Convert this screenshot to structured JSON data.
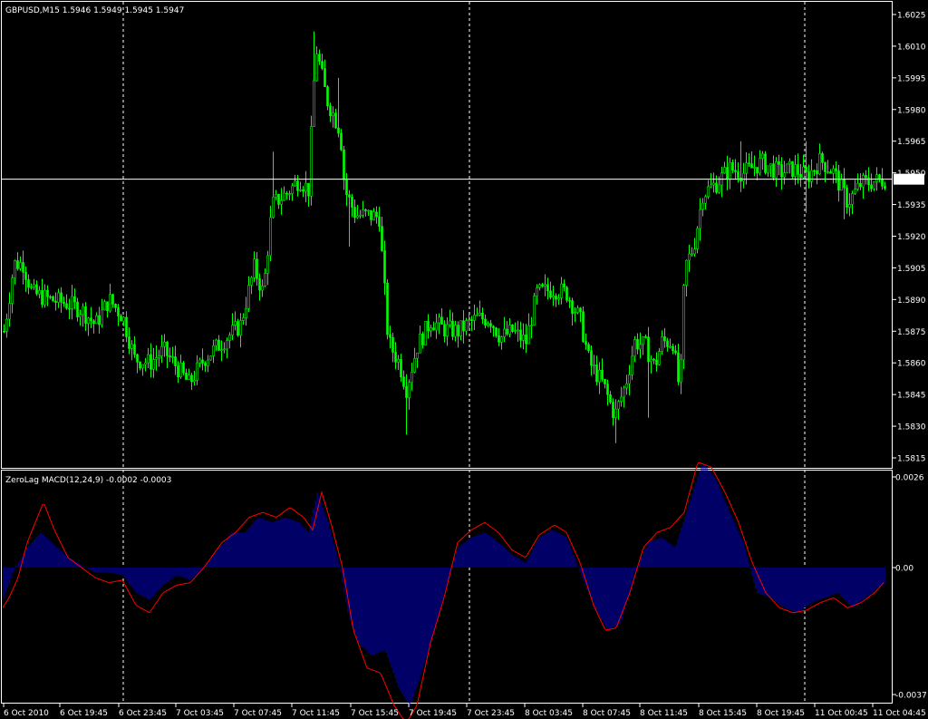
{
  "colors": {
    "background": "#000000",
    "frame": "#ffffff",
    "bull_candle": "#00ff00",
    "bear_candle": "#00ff00",
    "histogram": "#0000cc",
    "signal": "#ff0000",
    "bid_line": "#ffffff",
    "price_badge_bg": "#ffffff",
    "price_badge_text": "#000000"
  },
  "chart_data": [
    {
      "type": "candlestick",
      "title": "GBPUSD,M15  1.5946 1.5949 1.5945 1.5947",
      "symbol": "GBPUSD",
      "timeframe": "M15",
      "current_price": "1.5947",
      "ylim": [
        1.5809,
        1.603
      ],
      "y_ticks": [
        "1.6025",
        "1.6010",
        "1.5995",
        "1.5980",
        "1.5965",
        "1.5950",
        "1.5935",
        "1.5920",
        "1.5905",
        "1.5890",
        "1.5875",
        "1.5860",
        "1.5845",
        "1.5830",
        "1.5815"
      ],
      "grid": "vertical dashed separators at 6 Oct 19:45-23:45, 7 Oct 19:45-23:45, 10 Oct 21:00",
      "anchors": [
        [
          0,
          1.5865
        ],
        [
          6,
          1.588
        ],
        [
          15,
          1.5907
        ],
        [
          25,
          1.5907
        ],
        [
          35,
          1.5893
        ],
        [
          55,
          1.589
        ],
        [
          75,
          1.5888
        ],
        [
          90,
          1.5885
        ],
        [
          105,
          1.5878
        ],
        [
          120,
          1.589
        ],
        [
          135,
          1.5882
        ],
        [
          148,
          1.5862
        ],
        [
          165,
          1.586
        ],
        [
          180,
          1.5866
        ],
        [
          195,
          1.5858
        ],
        [
          208,
          1.585
        ],
        [
          225,
          1.5862
        ],
        [
          245,
          1.587
        ],
        [
          265,
          1.5878
        ],
        [
          280,
          1.5905
        ],
        [
          290,
          1.5893
        ],
        [
          300,
          1.5935
        ],
        [
          315,
          1.594
        ],
        [
          330,
          1.5947
        ],
        [
          340,
          1.5942
        ],
        [
          348,
          1.601
        ],
        [
          360,
          1.5985
        ],
        [
          375,
          1.597
        ],
        [
          380,
          1.5942
        ],
        [
          392,
          1.593
        ],
        [
          405,
          1.593
        ],
        [
          418,
          1.5929
        ],
        [
          428,
          1.587
        ],
        [
          440,
          1.586
        ],
        [
          448,
          1.5848
        ],
        [
          460,
          1.5868
        ],
        [
          475,
          1.588
        ],
        [
          490,
          1.5876
        ],
        [
          505,
          1.5875
        ],
        [
          525,
          1.5881
        ],
        [
          540,
          1.5881
        ],
        [
          552,
          1.5872
        ],
        [
          565,
          1.5875
        ],
        [
          580,
          1.587
        ],
        [
          592,
          1.5893
        ],
        [
          610,
          1.5895
        ],
        [
          625,
          1.5893
        ],
        [
          640,
          1.588
        ],
        [
          650,
          1.586
        ],
        [
          665,
          1.585
        ],
        [
          678,
          1.5835
        ],
        [
          690,
          1.585
        ],
        [
          700,
          1.587
        ],
        [
          712,
          1.5868
        ],
        [
          722,
          1.5858
        ],
        [
          730,
          1.587
        ],
        [
          742,
          1.587
        ],
        [
          750,
          1.5845
        ],
        [
          755,
          1.5905
        ],
        [
          765,
          1.5915
        ],
        [
          775,
          1.594
        ],
        [
          790,
          1.5945
        ],
        [
          805,
          1.5952
        ],
        [
          820,
          1.595
        ],
        [
          840,
          1.5955
        ],
        [
          860,
          1.595
        ],
        [
          875,
          1.5952
        ],
        [
          890,
          1.5948
        ],
        [
          905,
          1.5956
        ],
        [
          920,
          1.595
        ],
        [
          935,
          1.5936
        ],
        [
          950,
          1.5945
        ],
        [
          965,
          1.5946
        ],
        [
          978,
          1.5947
        ]
      ],
      "spikes": [
        {
          "x": 300,
          "high": 1.596
        },
        {
          "x": 345,
          "high": 1.6017
        },
        {
          "x": 372,
          "high": 1.5995
        },
        {
          "x": 386,
          "low": 1.5915
        },
        {
          "x": 448,
          "low": 1.5826
        },
        {
          "x": 680,
          "low": 1.5822
        },
        {
          "x": 715,
          "low": 1.5834
        },
        {
          "x": 818,
          "high": 1.5965
        },
        {
          "x": 888,
          "high": 1.5965
        },
        {
          "x": 888,
          "low": 1.5931
        },
        {
          "x": 930,
          "low": 1.5928
        }
      ]
    },
    {
      "type": "histogram+line",
      "title": "ZeroLag MACD(12,24,9) -0.0002 -0.0003",
      "ylim": [
        -0.0037,
        0.0026
      ],
      "y_ticks": [
        "0.0026",
        "0.00",
        "-0.0037"
      ],
      "macd_anchors": [
        [
          0,
          -0.0016
        ],
        [
          15,
          -0.0001
        ],
        [
          30,
          0.0008
        ],
        [
          45,
          0.0014
        ],
        [
          60,
          0.0009
        ],
        [
          75,
          0.0004
        ],
        [
          90,
          0.0001
        ],
        [
          105,
          -0.0002
        ],
        [
          120,
          -0.0002
        ],
        [
          135,
          -0.0003
        ],
        [
          150,
          -0.001
        ],
        [
          165,
          -0.0013
        ],
        [
          180,
          -0.0007
        ],
        [
          195,
          -0.0003
        ],
        [
          210,
          -0.0005
        ],
        [
          225,
          0.0
        ],
        [
          240,
          0.0007
        ],
        [
          255,
          0.0014
        ],
        [
          270,
          0.0014
        ],
        [
          285,
          0.002
        ],
        [
          300,
          0.0018
        ],
        [
          315,
          0.002
        ],
        [
          330,
          0.0018
        ],
        [
          340,
          0.0014
        ],
        [
          350,
          0.003
        ],
        [
          362,
          0.0018
        ],
        [
          375,
          0.0
        ],
        [
          385,
          -0.002
        ],
        [
          395,
          -0.003
        ],
        [
          410,
          -0.0035
        ],
        [
          425,
          -0.0033
        ],
        [
          440,
          -0.0048
        ],
        [
          452,
          -0.0055
        ],
        [
          462,
          -0.0045
        ],
        [
          475,
          -0.003
        ],
        [
          490,
          -0.001
        ],
        [
          505,
          0.0008
        ],
        [
          520,
          0.0012
        ],
        [
          535,
          0.0014
        ],
        [
          550,
          0.001
        ],
        [
          565,
          0.0005
        ],
        [
          580,
          0.0002
        ],
        [
          595,
          0.0012
        ],
        [
          610,
          0.0015
        ],
        [
          625,
          0.0012
        ],
        [
          640,
          -0.0002
        ],
        [
          655,
          -0.0015
        ],
        [
          670,
          -0.0025
        ],
        [
          685,
          -0.0022
        ],
        [
          700,
          -0.0002
        ],
        [
          715,
          0.001
        ],
        [
          730,
          0.0012
        ],
        [
          745,
          0.0008
        ],
        [
          760,
          0.0025
        ],
        [
          775,
          0.0042
        ],
        [
          790,
          0.0035
        ],
        [
          805,
          0.0022
        ],
        [
          820,
          0.001
        ],
        [
          835,
          -0.001
        ],
        [
          850,
          -0.0012
        ],
        [
          865,
          -0.0016
        ],
        [
          880,
          -0.0018
        ],
        [
          895,
          -0.0014
        ],
        [
          910,
          -0.0012
        ],
        [
          925,
          -0.001
        ],
        [
          940,
          -0.0016
        ],
        [
          955,
          -0.0012
        ],
        [
          968,
          -0.0008
        ],
        [
          978,
          -0.0006
        ]
      ],
      "signal_anchors": [
        [
          3,
          -0.0016
        ],
        [
          10,
          -0.0012
        ],
        [
          20,
          -0.0004
        ],
        [
          30,
          0.001
        ],
        [
          48,
          0.0026
        ],
        [
          60,
          0.0015
        ],
        [
          75,
          0.0004
        ],
        [
          90,
          0.0
        ],
        [
          105,
          -0.0004
        ],
        [
          120,
          -0.0006
        ],
        [
          135,
          -0.0005
        ],
        [
          150,
          -0.0015
        ],
        [
          165,
          -0.0018
        ],
        [
          180,
          -0.001
        ],
        [
          195,
          -0.0007
        ],
        [
          210,
          -0.0006
        ],
        [
          225,
          0.0
        ],
        [
          245,
          0.001
        ],
        [
          260,
          0.0014
        ],
        [
          275,
          0.002
        ],
        [
          290,
          0.0022
        ],
        [
          305,
          0.002
        ],
        [
          320,
          0.0024
        ],
        [
          335,
          0.002
        ],
        [
          345,
          0.0015
        ],
        [
          355,
          0.003
        ],
        [
          365,
          0.0018
        ],
        [
          378,
          0.0
        ],
        [
          390,
          -0.0025
        ],
        [
          405,
          -0.004
        ],
        [
          420,
          -0.0042
        ],
        [
          435,
          -0.0055
        ],
        [
          448,
          -0.0062
        ],
        [
          460,
          -0.0055
        ],
        [
          475,
          -0.003
        ],
        [
          490,
          -0.0012
        ],
        [
          505,
          0.001
        ],
        [
          520,
          0.0015
        ],
        [
          535,
          0.0018
        ],
        [
          550,
          0.0014
        ],
        [
          565,
          0.0007
        ],
        [
          580,
          0.0004
        ],
        [
          595,
          0.0013
        ],
        [
          612,
          0.0017
        ],
        [
          625,
          0.0014
        ],
        [
          640,
          0.0002
        ],
        [
          655,
          -0.0015
        ],
        [
          668,
          -0.0025
        ],
        [
          680,
          -0.0024
        ],
        [
          695,
          -0.001
        ],
        [
          710,
          0.0008
        ],
        [
          725,
          0.0014
        ],
        [
          740,
          0.0016
        ],
        [
          755,
          0.0022
        ],
        [
          770,
          0.0042
        ],
        [
          785,
          0.004
        ],
        [
          800,
          0.003
        ],
        [
          815,
          0.0018
        ],
        [
          830,
          0.0002
        ],
        [
          845,
          -0.001
        ],
        [
          860,
          -0.0016
        ],
        [
          875,
          -0.0018
        ],
        [
          890,
          -0.0017
        ],
        [
          905,
          -0.0014
        ],
        [
          920,
          -0.0012
        ],
        [
          935,
          -0.0016
        ],
        [
          950,
          -0.0014
        ],
        [
          965,
          -0.001
        ],
        [
          975,
          -0.0006
        ]
      ]
    }
  ],
  "x_ticks": [
    "6 Oct 2010",
    "6 Oct 19:45",
    "6 Oct 23:45",
    "7 Oct 03:45",
    "7 Oct 07:45",
    "7 Oct 11:45",
    "7 Oct 15:45",
    "7 Oct 19:45",
    "7 Oct 23:45",
    "8 Oct 03:45",
    "8 Oct 07:45",
    "8 Oct 11:45",
    "8 Oct 15:45",
    "8 Oct 19:45",
    "11 Oct 00:45",
    "11 Oct 04:45"
  ]
}
